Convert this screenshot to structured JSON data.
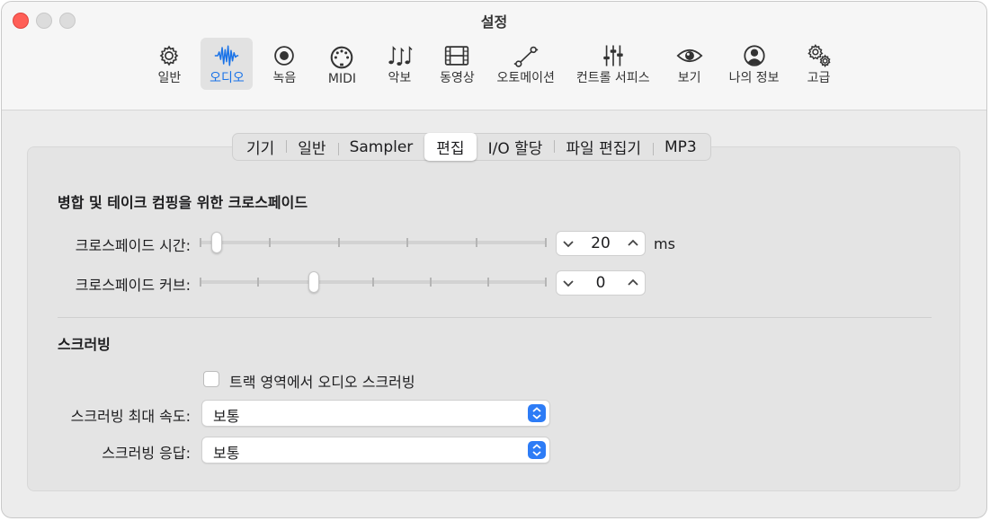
{
  "window": {
    "title": "설정",
    "accent_color": "#1a73e8"
  },
  "toolbar": {
    "items": [
      {
        "label": "일반",
        "icon": "gear-icon"
      },
      {
        "label": "오디오",
        "icon": "waveform-icon"
      },
      {
        "label": "녹음",
        "icon": "record-icon"
      },
      {
        "label": "MIDI",
        "icon": "midi-port-icon"
      },
      {
        "label": "악보",
        "icon": "music-notes-icon"
      },
      {
        "label": "동영상",
        "icon": "film-icon"
      },
      {
        "label": "오토메이션",
        "icon": "automation-curve-icon"
      },
      {
        "label": "컨트롤 서피스",
        "icon": "faders-icon"
      },
      {
        "label": "보기",
        "icon": "eye-icon"
      },
      {
        "label": "나의 정보",
        "icon": "person-icon"
      },
      {
        "label": "고급",
        "icon": "gears-icon"
      }
    ],
    "selected": "오디오"
  },
  "tabs": {
    "items": [
      "기기",
      "일반",
      "Sampler",
      "편집",
      "I/O 할당",
      "파일 편집기",
      "MP3"
    ],
    "selected": "편집"
  },
  "crossfade": {
    "section_title": "병합 및 테이크 컴핑을 위한 크로스페이드",
    "time": {
      "label": "크로스페이드 시간:",
      "value": "20",
      "unit": "ms",
      "slider_fraction": 0.05
    },
    "curve": {
      "label": "크로스페이드 커브:",
      "value": "0",
      "slider_fraction": 0.33
    }
  },
  "scrubbing": {
    "section_title": "스크러빙",
    "checkbox": {
      "label": "트랙 영역에서 오디오 스크러빙",
      "checked": false
    },
    "max_speed": {
      "label": "스크러빙 최대 속도:",
      "value": "보통"
    },
    "response": {
      "label": "스크러빙 응답:",
      "value": "보통"
    }
  }
}
